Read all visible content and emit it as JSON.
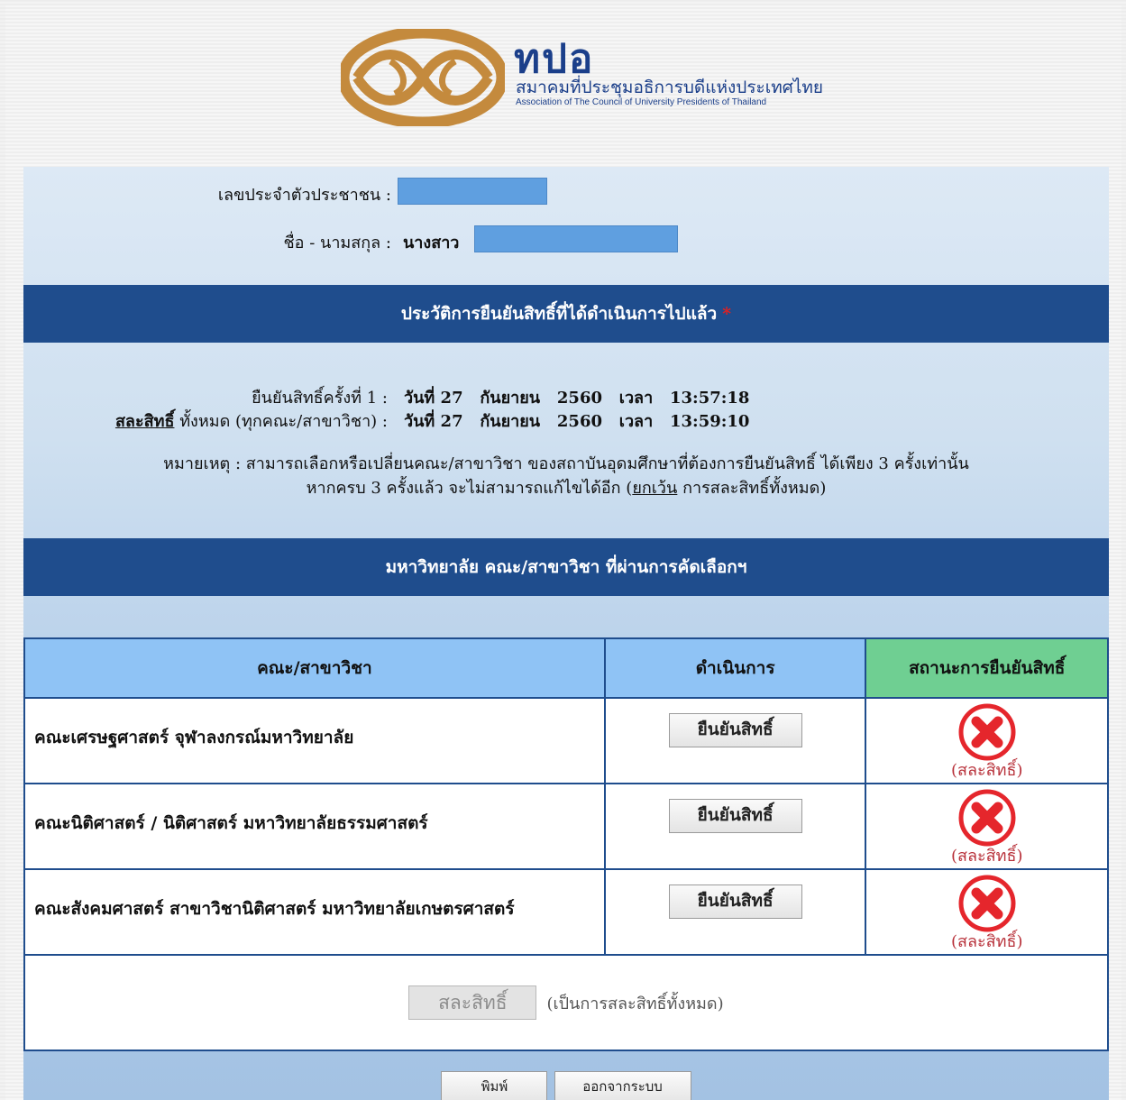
{
  "header": {
    "logo_abbr": "ทปอ",
    "logo_th": "สมาคมที่ประชุมอธิการบดีแห่งประเทศไทย",
    "logo_en": "Association of The Council of University Presidents of Thailand"
  },
  "person": {
    "id_label": "เลขประจำตัวประชาชน :",
    "name_label": "ชื่อ - นามสกุล :",
    "name_prefix": "นางสาว"
  },
  "history": {
    "title": "ประวัติการยืนยันสิทธิ์ที่ได้ดำเนินการไปแล้ว",
    "required_mark": "*",
    "confirm_label": "ยืนยันสิทธิ์ครั้งที่ 1 :",
    "confirm_value": "วันที่ 27   กันยายน   2560   เวลา   13:57:18",
    "waive_word": "สละสิทธิ์",
    "waive_rest": " ทั้งหมด (ทุกคณะ/สาขาวิชา) :",
    "waive_value": "วันที่ 27   กันยายน   2560   เวลา   13:59:10",
    "note_line1": "หมายเหตุ : สามารถเลือกหรือเปลี่ยนคณะ/สาขาวิชา ของสถาบันอุดมศึกษาที่ต้องการยืนยันสิทธิ์ ได้เพียง 3 ครั้งเท่านั้น",
    "note_line2_a": "หากครบ 3 ครั้งแล้ว จะไม่สามารถแก้ไขได้อีก (",
    "note_line2_u": "ยกเว้น",
    "note_line2_b": " การสละสิทธิ์ทั้งหมด)"
  },
  "selection": {
    "title": "มหาวิทยาลัย คณะ/สาขาวิชา ที่ผ่านการคัดเลือกฯ",
    "columns": [
      "คณะ/สาขาวิชา",
      "ดำเนินการ",
      "สถานะการยืนยันสิทธิ์"
    ],
    "rows": [
      {
        "faculty": "คณะเศรษฐศาสตร์ จุฬาลงกรณ์มหาวิทยาลัย",
        "action": "ยืนยันสิทธิ์",
        "status": "(สละสิทธิ์)"
      },
      {
        "faculty": "คณะนิติศาสตร์ / นิติศาสตร์ มหาวิทยาลัยธรรมศาสตร์",
        "action": "ยืนยันสิทธิ์",
        "status": "(สละสิทธิ์)"
      },
      {
        "faculty": "คณะสังคมศาสตร์ สาขาวิชานิติศาสตร์ มหาวิทยาลัยเกษตรศาสตร์",
        "action": "ยืนยันสิทธิ์",
        "status": "(สละสิทธิ์)"
      }
    ],
    "waive_all_button": "สละสิทธิ์",
    "waive_all_note": "(เป็นการสละสิทธิ์ทั้งหมด)"
  },
  "footer": {
    "print_button": "พิมพ์",
    "logout_button": "ออกจากระบบ"
  },
  "colors": {
    "band": "#1f4d8d",
    "header_blue": "#8fc3f5",
    "header_green": "#6fcf92",
    "status_red": "#e5262c",
    "logo_gold": "#c48a3d"
  }
}
